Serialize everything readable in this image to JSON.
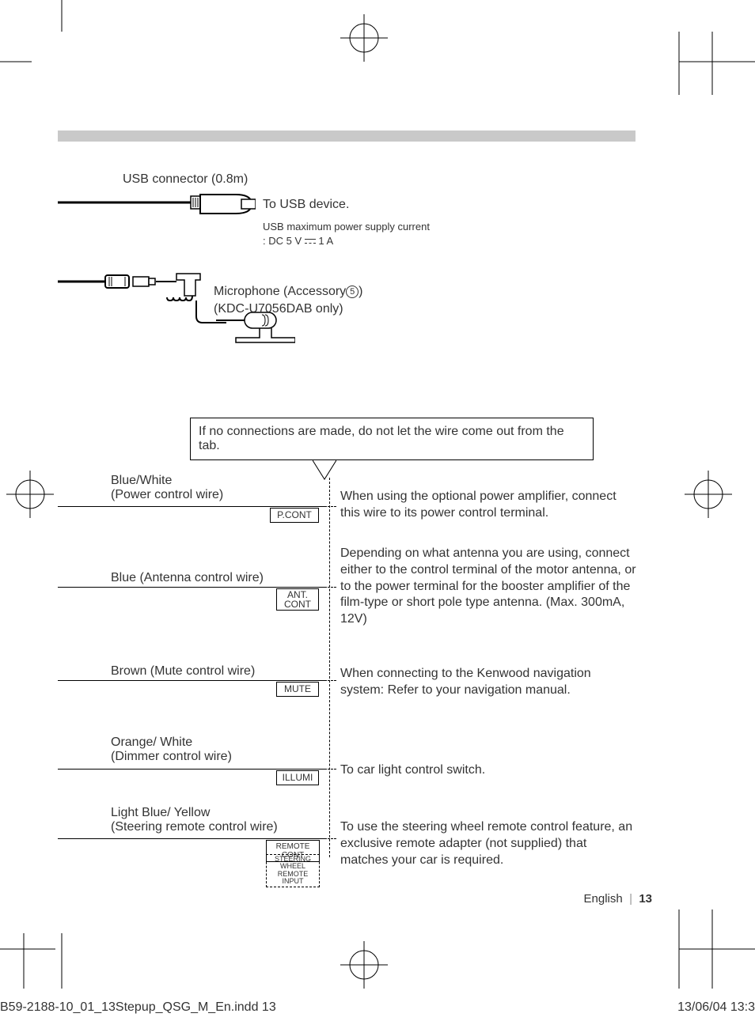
{
  "usb": {
    "connector_label": "USB connector (0.8m)",
    "to_label": "To USB device.",
    "max_current_line1": "USB maximum power supply current",
    "max_current_prefix": ": DC 5 V ",
    "max_current_suffix": " 1 A"
  },
  "mic": {
    "line1_prefix": "Microphone (Accessory",
    "line1_num": "5",
    "line1_suffix": ")",
    "line2": "(KDC-U7056DAB only)"
  },
  "callout": {
    "text": "If no connections are made, do not let the wire come out from the tab."
  },
  "wires": [
    {
      "color_label": "Blue/White",
      "name": "(Power control wire)",
      "tag": "P.CONT",
      "desc": "When using the optional power amplifier, connect this wire to its power control terminal."
    },
    {
      "color_label": "Blue (Antenna control wire)",
      "name": "",
      "tag": "ANT. CONT",
      "desc": "Depending on what antenna you are using, connect either to the control terminal of the motor antenna, or to the power terminal for the booster amplifier of the film-type or short pole type antenna. (Max. 300mA, 12V)"
    },
    {
      "color_label": "Brown (Mute control wire)",
      "name": "",
      "tag": "MUTE",
      "desc": "When connecting to the Kenwood navigation system: Refer to your navigation manual."
    },
    {
      "color_label": "Orange/ White",
      "name": "(Dimmer control wire)",
      "tag": "ILLUMI",
      "desc": "To car light control switch."
    },
    {
      "color_label": "Light Blue/ Yellow",
      "name": "(Steering remote control wire)",
      "tag": "REMOTE CONT",
      "tag2a": "STEERING WHEEL",
      "tag2b": "REMOTE INPUT",
      "desc": "To use the steering wheel remote control feature, an exclusive remote adapter (not supplied) that matches your car is required."
    }
  ],
  "footer": {
    "lang": "English",
    "sep": "|",
    "page": "13",
    "file": "B59-2188-10_01_13Stepup_QSG_M_En.indd   13",
    "timestamp": "13/06/04   13:3"
  }
}
